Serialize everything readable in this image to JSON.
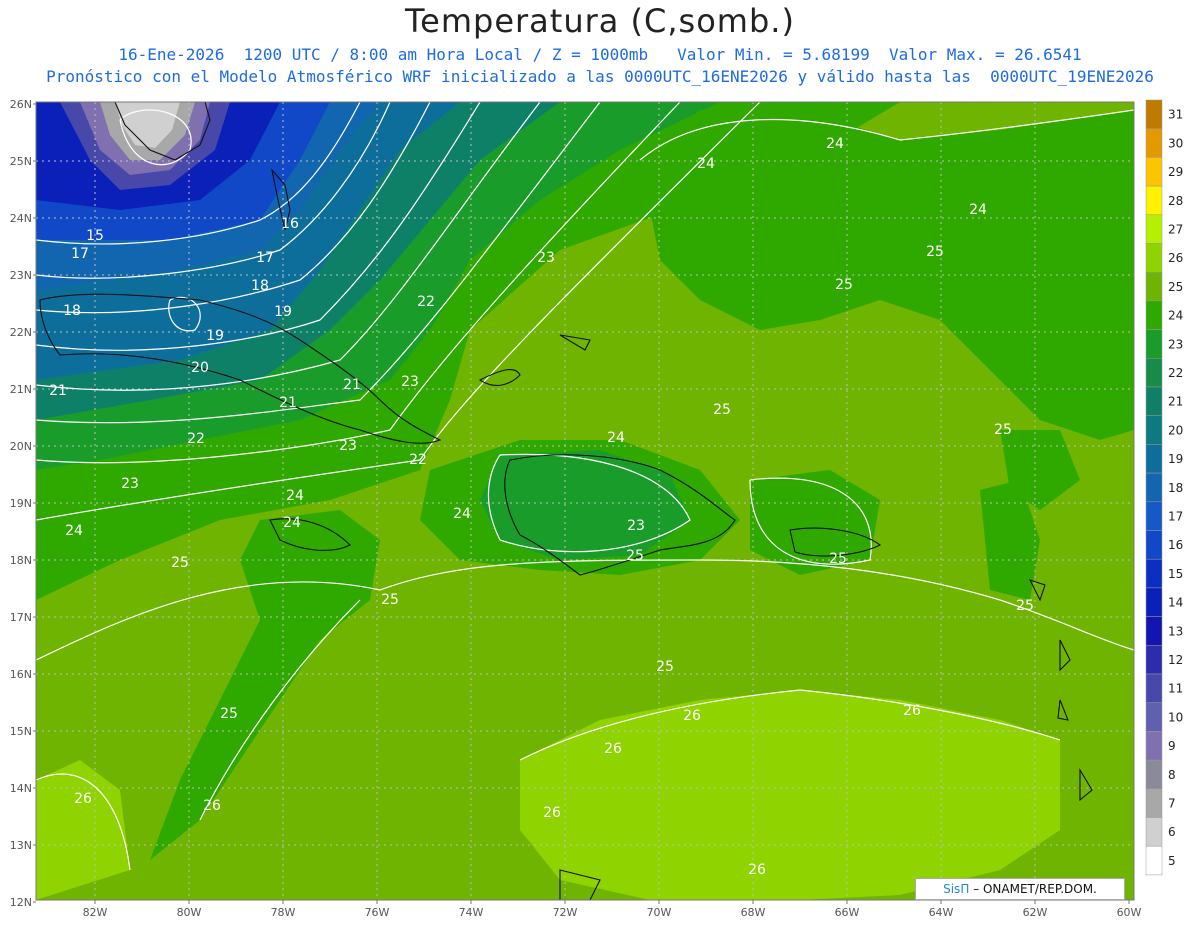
{
  "header": {
    "title": "Temperatura (C,somb.)",
    "subtitle_line1": "16-Ene-2026  1200 UTC / 8:00 am Hora Local / Z = 1000mb   Valor Min. = 5.68199  Valor Max. = 26.6541",
    "subtitle_line2": "Pronóstico con el Modelo Atmosférico WRF inicializado a las 0000UTC_16ENE2026 y válido hasta las  0000UTC_19ENE2026"
  },
  "axes": {
    "lat_labels": [
      "26N",
      "25N",
      "24N",
      "23N",
      "22N",
      "21N",
      "20N",
      "19N",
      "18N",
      "17N",
      "16N",
      "15N",
      "14N",
      "13N",
      "12N"
    ],
    "lon_labels": [
      "82W",
      "80W",
      "78W",
      "76W",
      "74W",
      "72W",
      "70W",
      "68W",
      "66W",
      "64W",
      "62W",
      "60W"
    ]
  },
  "colorbar": {
    "levels": [
      "31",
      "30",
      "29",
      "28",
      "27",
      "26",
      "25",
      "24",
      "23",
      "22",
      "21",
      "20",
      "19",
      "18",
      "17",
      "16",
      "15",
      "14",
      "13",
      "12",
      "11",
      "10",
      "9",
      "8",
      "7",
      "6",
      "5"
    ],
    "colors": [
      "#c07a00",
      "#e39a00",
      "#ffc400",
      "#fff200",
      "#b4f000",
      "#8fd400",
      "#6fb400",
      "#2fa800",
      "#1a9c2a",
      "#178c4a",
      "#0f8068",
      "#0c7a80",
      "#0d6e9c",
      "#1266b0",
      "#1559c8",
      "#1048c8",
      "#0b2fc0",
      "#0a20b8",
      "#1414b0",
      "#2c2cac",
      "#4848aa",
      "#6060b0",
      "#8070b0",
      "#8a8a9a",
      "#a8a8a8",
      "#d0d0d0",
      "#ffffff"
    ]
  },
  "contour_labels": [
    "15",
    "16",
    "17",
    "17",
    "18",
    "18",
    "19",
    "19",
    "20",
    "21",
    "21",
    "21",
    "22",
    "22",
    "22",
    "23",
    "23",
    "23",
    "23",
    "23",
    "24",
    "24",
    "24",
    "24",
    "24",
    "24",
    "24",
    "24",
    "25",
    "25",
    "25",
    "25",
    "25",
    "25",
    "25",
    "25",
    "25",
    "25",
    "25",
    "26",
    "26",
    "26",
    "26",
    "26",
    "26",
    "26"
  ],
  "credit": {
    "brand": "SisΠ",
    "text": " – ONAMET/REP.DOM."
  }
}
